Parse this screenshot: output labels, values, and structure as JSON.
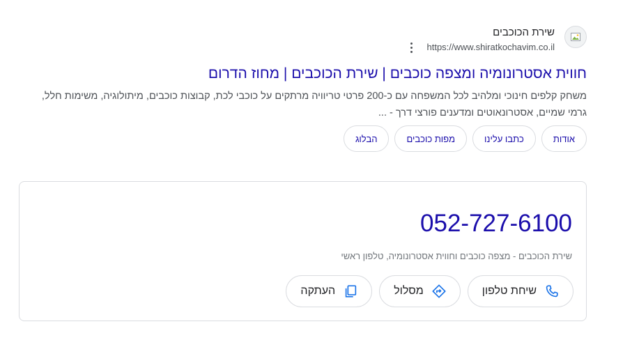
{
  "result": {
    "site_name": "שירת הכוכבים",
    "site_url": "https://www.shiratkochavim.co.il",
    "favicon_icon": "broken-image-icon",
    "more_icon": "three-dots-vertical-icon",
    "title": "חווית אסטרונומיה ומצפה כוכבים | שירת הכוכבים | מחוז הדרום",
    "snippet": "משחק קלפים חינוכי ומלהיב לכל המשפחה עם כ-200 פרטי טריוויה מרתקים על כוכבי לכת, קבוצות כוכבים, מיתולוגיה, משימות חלל, גרמי שמיים, אסטרונאוטים ומדענים פורצי דרך - ...",
    "sitelinks": [
      "אודות",
      "כתבו עלינו",
      "מפות כוכבים",
      "הבלוג"
    ]
  },
  "phone_card": {
    "number": "052-727-6100",
    "description": "שירת הכוכבים - מצפה כוכבים וחווית אסטרונומיה, טלפון ראשי",
    "actions": {
      "call": {
        "label": "שיחת טלפון",
        "icon": "phone-icon"
      },
      "directions": {
        "label": "מסלול",
        "icon": "directions-icon"
      },
      "copy": {
        "label": "העתקה",
        "icon": "copy-icon"
      }
    }
  },
  "colors": {
    "link": "#1a0dab",
    "text": "#202124",
    "muted": "#4d5156",
    "border": "#dadce0",
    "icon_blue": "#1a73e8"
  }
}
